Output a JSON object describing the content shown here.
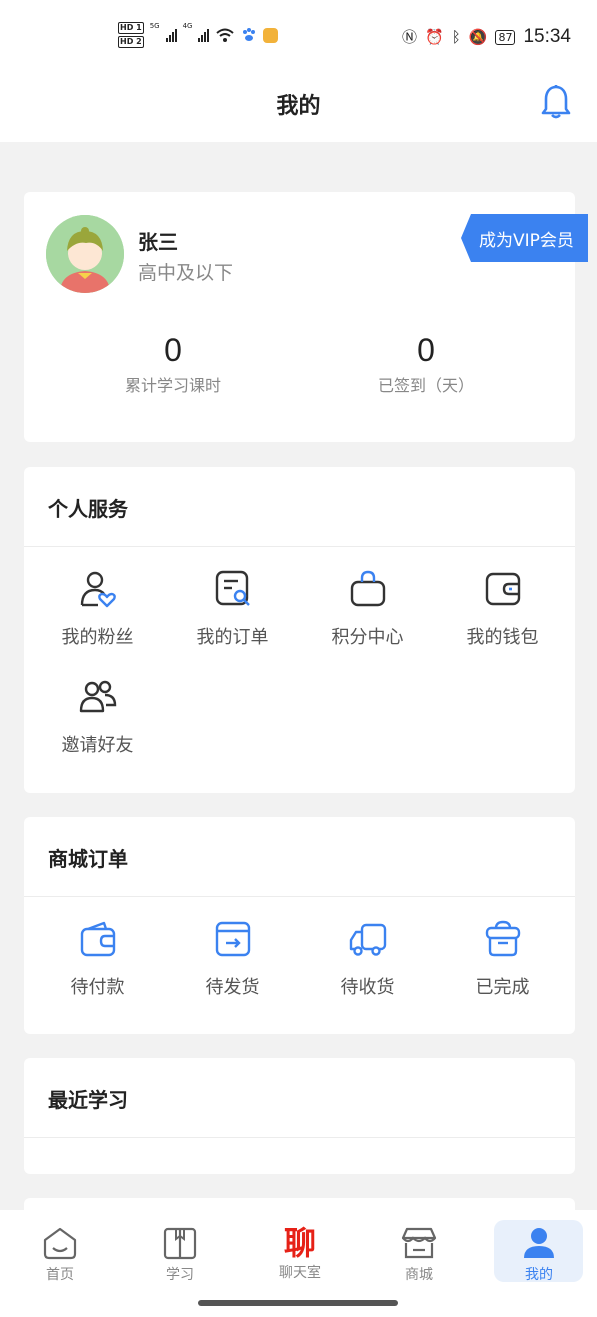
{
  "status_bar": {
    "time": "15:34",
    "battery": "87",
    "sim1": "HD 1",
    "sim2": "HD 2",
    "net1": "5G",
    "net2": "4G",
    "icons": [
      "nfc-icon",
      "alarm-icon",
      "bluetooth-icon",
      "mute-icon"
    ]
  },
  "header": {
    "title": "我的"
  },
  "profile": {
    "name": "张三",
    "grade": "高中及以下",
    "vip_label": "成为VIP会员",
    "stats": [
      {
        "value": "0",
        "label": "累计学习课时"
      },
      {
        "value": "0",
        "label": "已签到（天）"
      }
    ]
  },
  "personal_services": {
    "title": "个人服务",
    "items": [
      {
        "label": "我的粉丝",
        "icon": "fans-icon"
      },
      {
        "label": "我的订单",
        "icon": "order-icon"
      },
      {
        "label": "积分中心",
        "icon": "points-bag-icon"
      },
      {
        "label": "我的钱包",
        "icon": "wallet-icon"
      },
      {
        "label": "邀请好友",
        "icon": "invite-friends-icon"
      }
    ]
  },
  "shop_orders": {
    "title": "商城订单",
    "items": [
      {
        "label": "待付款",
        "icon": "wallet-icon"
      },
      {
        "label": "待发货",
        "icon": "box-icon"
      },
      {
        "label": "待收货",
        "icon": "truck-icon"
      },
      {
        "label": "已完成",
        "icon": "gift-box-icon"
      }
    ]
  },
  "recent_study": {
    "title": "最近学习"
  },
  "bottom_nav": {
    "items": [
      {
        "label": "首页",
        "icon": "home-icon"
      },
      {
        "label": "学习",
        "icon": "book-icon"
      },
      {
        "label": "聊天室",
        "icon": "chat-room-icon",
        "glyph": "聊"
      },
      {
        "label": "商城",
        "icon": "store-icon"
      },
      {
        "label": "我的",
        "icon": "user-icon",
        "active": true
      }
    ]
  },
  "colors": {
    "accent": "#3b82f0",
    "chat_red": "#e62117",
    "background": "#f2f2f2"
  }
}
